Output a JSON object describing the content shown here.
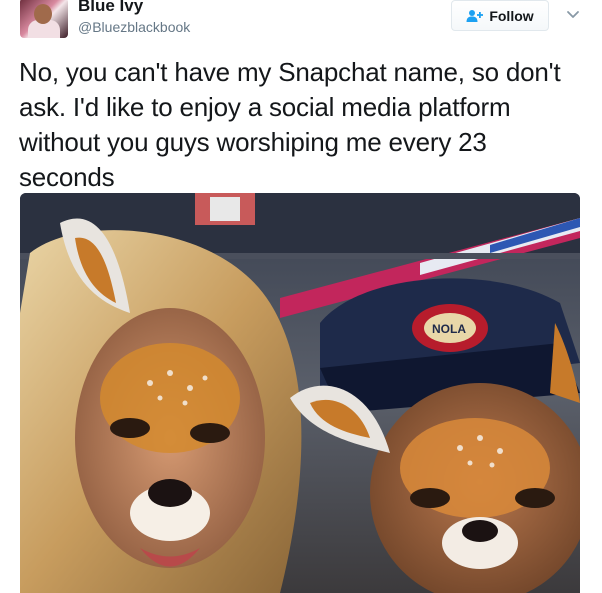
{
  "user": {
    "display_name": "Blue Ivy",
    "screen_name": "@Bluezblackbook",
    "avatar_icon": "profile-photo"
  },
  "actions": {
    "follow_label": "Follow",
    "follow_icon": "add-user-icon",
    "menu_icon": "chevron-down-icon"
  },
  "tweet": {
    "text": "No, you can't have my Snapchat name, so don't ask. I'd like to enjoy a social media platform without you guys worshiping me every 23 seconds"
  },
  "media": {
    "description_icon": "selfie-photo-with-deer-filter",
    "cap_logo_text": "NOLA"
  },
  "colors": {
    "text": "#14171a",
    "secondary": "#657786",
    "follow_icon": "#1da1f2",
    "border": "#e1e8ed"
  }
}
